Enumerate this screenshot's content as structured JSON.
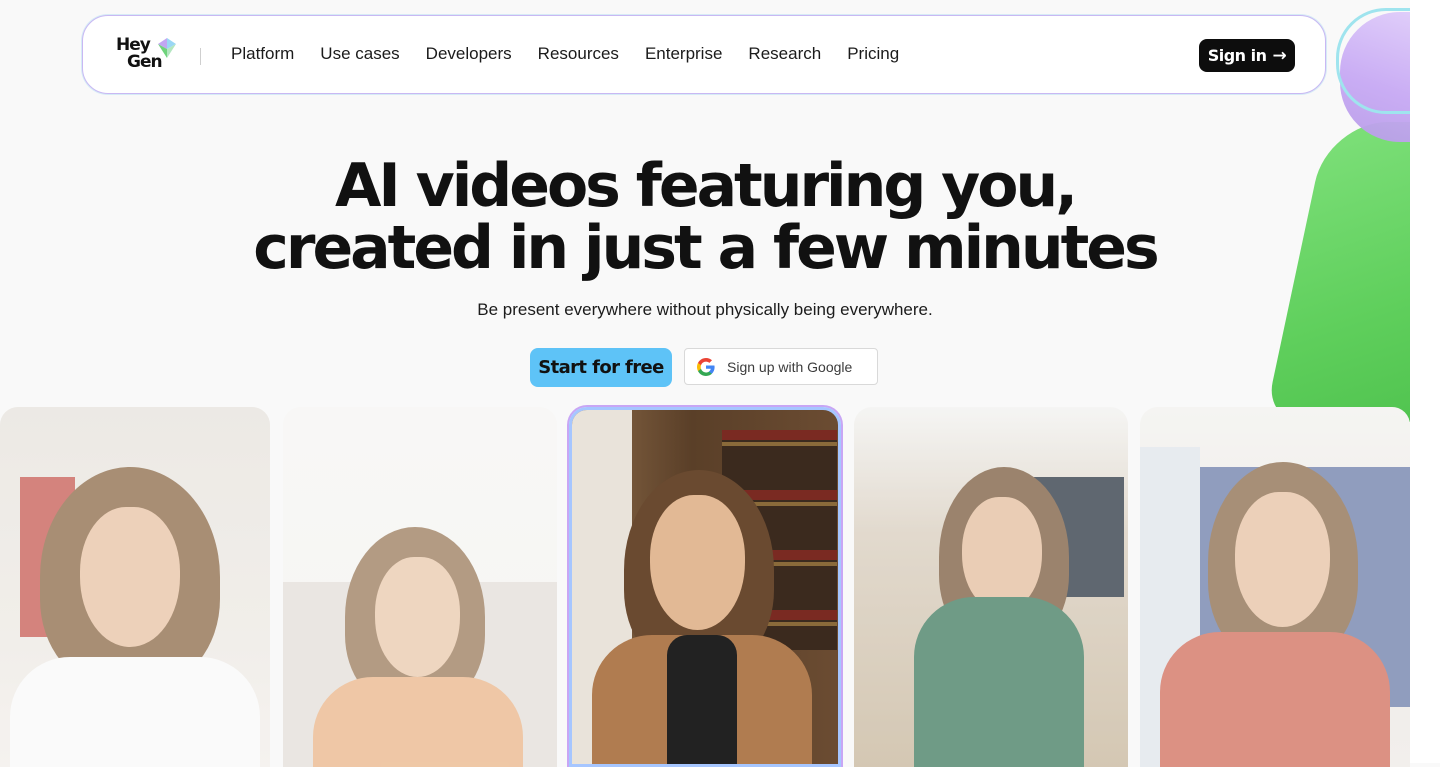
{
  "brand": {
    "logo_line1": "Hey",
    "logo_line2": "Gen",
    "logo_icon": "heygen-gem-icon"
  },
  "nav": {
    "items": [
      "Platform",
      "Use cases",
      "Developers",
      "Resources",
      "Enterprise",
      "Research",
      "Pricing"
    ],
    "signin_label": "Sign in"
  },
  "hero": {
    "title_line1": "AI videos featuring you,",
    "title_line2": "created in just a few minutes",
    "subtitle": "Be present everywhere without physically being everywhere."
  },
  "cta": {
    "start_label": "Start for free",
    "google_label": "Sign up with Google",
    "google_icon": "google-g-icon"
  },
  "colors": {
    "accent_blue": "#5ec3f7",
    "nav_border": "#c9b8f3",
    "signin_bg": "#0d0d0d",
    "blob_green": "#5fcf5c",
    "blob_purple": "#c7a9f4"
  },
  "gallery": {
    "cards": [
      "avatar-video-1",
      "avatar-video-2",
      "avatar-video-3",
      "avatar-video-4",
      "avatar-video-5"
    ],
    "selected_index": 2
  }
}
